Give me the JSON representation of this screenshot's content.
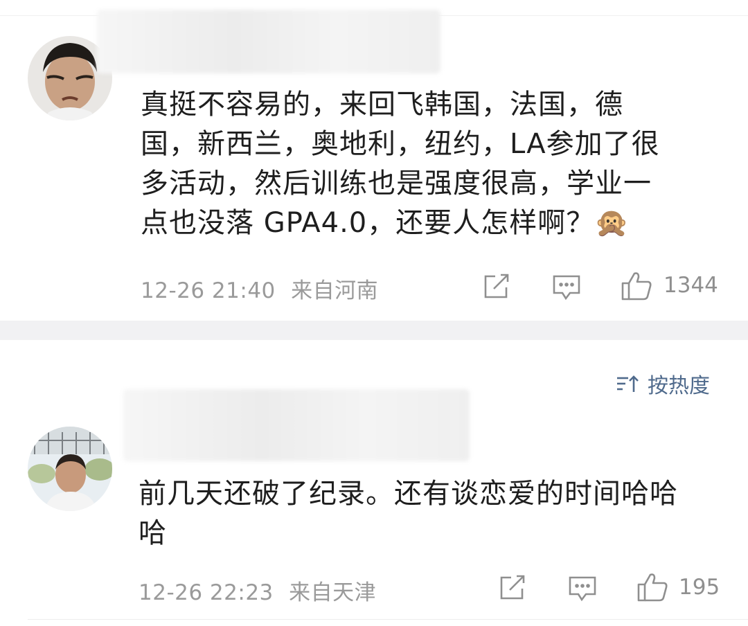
{
  "comments": [
    {
      "text_lines": [
        "真挺不容易的，来回飞韩国，法国，德",
        "国，新西兰，奥地利，纽约，LA参加了很",
        "多活动，然后训练也是强度很高，学业一",
        "点也没落 GPA4.0，还要人怎样啊？🙊"
      ],
      "time": "12-26 21:40",
      "location": "来自河南",
      "likes": "1344",
      "icons": [
        "share-icon",
        "comment-icon",
        "like-icon"
      ]
    },
    {
      "text_lines": [
        "前几天还破了纪录。还有谈恋爱的时间哈哈",
        "哈"
      ],
      "time": "12-26 22:23",
      "location": "来自天津",
      "likes": "195",
      "icons": [
        "share-icon",
        "comment-icon",
        "like-icon"
      ]
    }
  ],
  "sort": {
    "icon": "sort-icon",
    "label": "按热度"
  },
  "colors": {
    "meta": "#9a9a9a",
    "sort": "#4f6a8c",
    "divider": "#f1f1f3"
  }
}
